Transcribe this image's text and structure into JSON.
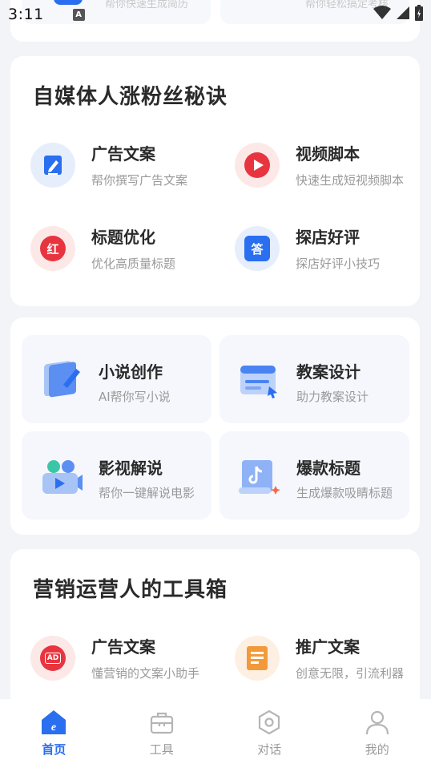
{
  "status_bar": {
    "time": "3:11",
    "indicator": "A"
  },
  "top_partial": {
    "left_text": "帮你快速生成简历",
    "right_text": "帮你轻松搞定考核"
  },
  "section_media": {
    "title": "自媒体人涨粉丝秘诀",
    "tools": [
      {
        "title": "广告文案",
        "subtitle": "帮你撰写广告文案",
        "icon": "pen-edit-icon"
      },
      {
        "title": "视频脚本",
        "subtitle": "快速生成短视频脚本",
        "icon": "play-icon"
      },
      {
        "title": "标题优化",
        "subtitle": "优化高质量标题",
        "icon": "hong-badge-icon",
        "glyph": "红"
      },
      {
        "title": "探店好评",
        "subtitle": "探店好评小技巧",
        "icon": "da-badge-icon",
        "glyph": "答"
      }
    ]
  },
  "section_creative": {
    "tiles": [
      {
        "title": "小说创作",
        "subtitle": "AI帮你写小说",
        "icon": "novel-book-icon"
      },
      {
        "title": "教案设计",
        "subtitle": "助力教案设计",
        "icon": "lesson-screen-icon"
      },
      {
        "title": "影视解说",
        "subtitle": "帮你一键解说电影",
        "icon": "video-narration-icon"
      },
      {
        "title": "爆款标题",
        "subtitle": "生成爆款吸睛标题",
        "icon": "tiktok-scroll-icon"
      }
    ]
  },
  "section_marketing": {
    "title": "营销运营人的工具箱",
    "tools": [
      {
        "title": "广告文案",
        "subtitle": "懂营销的文案小助手",
        "icon": "ad-badge-icon",
        "glyph": "AD"
      },
      {
        "title": "推广文案",
        "subtitle": "创意无限，引流利器",
        "icon": "document-icon"
      }
    ]
  },
  "bottom_nav": [
    {
      "label": "首页",
      "icon": "home-icon",
      "active": true
    },
    {
      "label": "工具",
      "icon": "toolbox-icon",
      "active": false
    },
    {
      "label": "对话",
      "icon": "chat-hex-icon",
      "active": false
    },
    {
      "label": "我的",
      "icon": "user-icon",
      "active": false
    }
  ],
  "colors": {
    "accent": "#2a6ff0",
    "red": "#e8343f",
    "orange": "#f29a3a"
  }
}
